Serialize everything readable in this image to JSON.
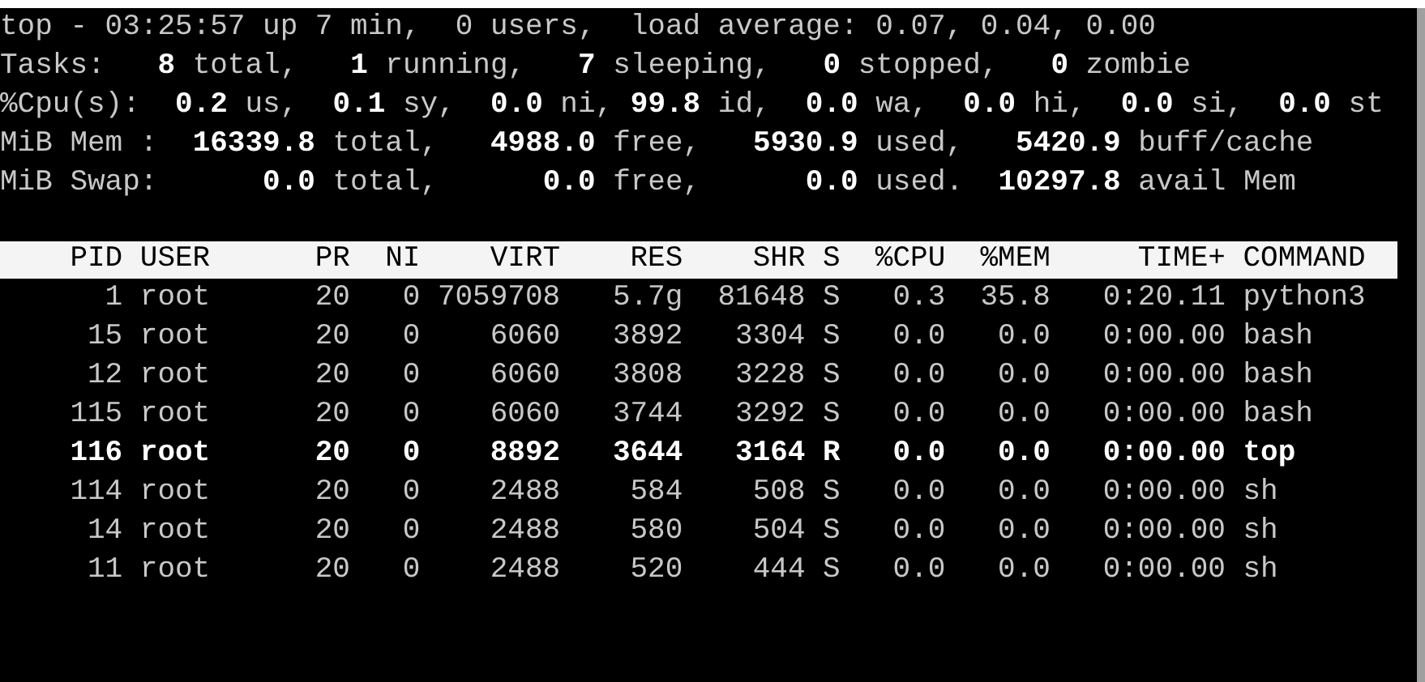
{
  "summary_lines": [
    "top - 03:25:57 up 7 min,  0 users,  load average: 0.07, 0.04, 0.00",
    "Tasks:   **8** total,   **1** running,   **7** sleeping,   **0** stopped,   **0** zombie",
    "%Cpu(s):  **0.2** us,  **0.1** sy,  **0.0** ni, **99.8** id,  **0.0** wa,  **0.0** hi,  **0.0** si,  **0.0** st",
    "MiB Mem :  **16339.8** total,   **4988.0** free,   **5930.9** used,   **5420.9** buff/cache",
    "MiB Swap:      **0.0** total,      **0.0** free,      **0.0** used.  **10297.8** avail Mem"
  ],
  "table": {
    "columns": [
      "PID",
      "USER",
      "PR",
      "NI",
      "VIRT",
      "RES",
      "SHR",
      "S",
      "%CPU",
      "%MEM",
      "TIME+",
      "COMMAND"
    ],
    "rows": [
      {
        "bold": false,
        "cells": [
          "1",
          "root",
          "20",
          "0",
          "7059708",
          "5.7g",
          "81648",
          "S",
          "0.3",
          "35.8",
          "0:20.11",
          "python3"
        ]
      },
      {
        "bold": false,
        "cells": [
          "15",
          "root",
          "20",
          "0",
          "6060",
          "3892",
          "3304",
          "S",
          "0.0",
          "0.0",
          "0:00.00",
          "bash"
        ]
      },
      {
        "bold": false,
        "cells": [
          "12",
          "root",
          "20",
          "0",
          "6060",
          "3808",
          "3228",
          "S",
          "0.0",
          "0.0",
          "0:00.00",
          "bash"
        ]
      },
      {
        "bold": false,
        "cells": [
          "115",
          "root",
          "20",
          "0",
          "6060",
          "3744",
          "3292",
          "S",
          "0.0",
          "0.0",
          "0:00.00",
          "bash"
        ]
      },
      {
        "bold": true,
        "cells": [
          "116",
          "root",
          "20",
          "0",
          "8892",
          "3644",
          "3164",
          "R",
          "0.0",
          "0.0",
          "0:00.00",
          "top"
        ]
      },
      {
        "bold": false,
        "cells": [
          "114",
          "root",
          "20",
          "0",
          "2488",
          "584",
          "508",
          "S",
          "0.0",
          "0.0",
          "0:00.00",
          "sh"
        ]
      },
      {
        "bold": false,
        "cells": [
          "14",
          "root",
          "20",
          "0",
          "2488",
          "580",
          "504",
          "S",
          "0.0",
          "0.0",
          "0:00.00",
          "sh"
        ]
      },
      {
        "bold": false,
        "cells": [
          "11",
          "root",
          "20",
          "0",
          "2488",
          "520",
          "444",
          "S",
          "0.0",
          "0.0",
          "0:00.00",
          "sh"
        ]
      }
    ]
  }
}
